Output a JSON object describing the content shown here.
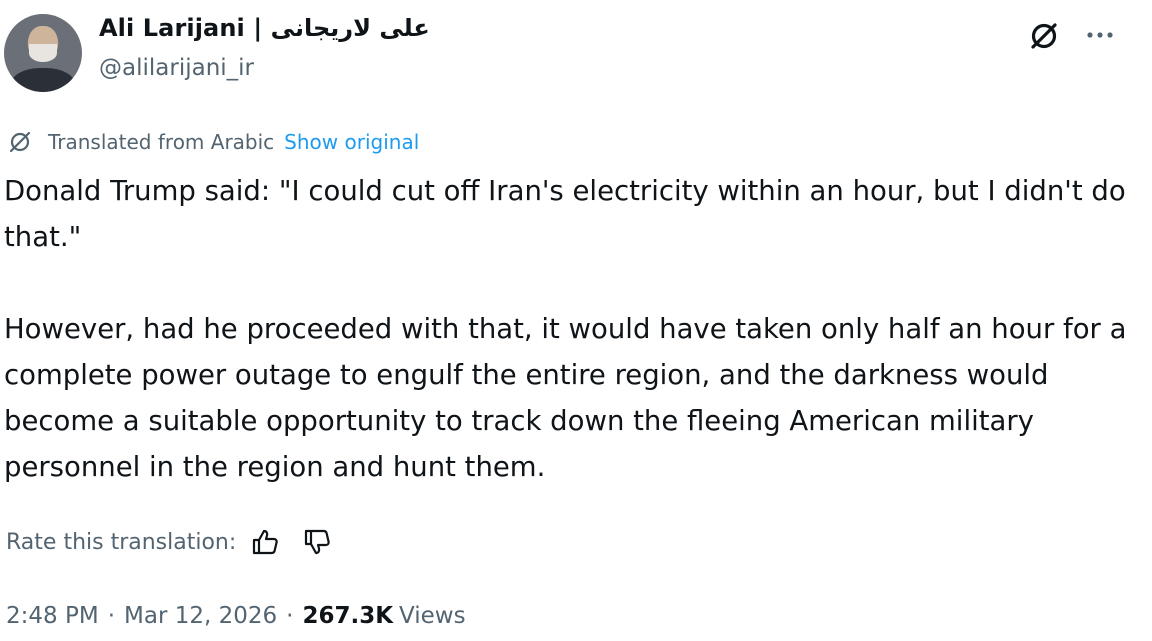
{
  "author": {
    "display_name": "Ali Larijani | علی لاریجانی",
    "handle": "@alilarijani_ir"
  },
  "header_icons": {
    "grok": "grok-icon",
    "more": "more-horizontal-icon"
  },
  "translation": {
    "notice": "Translated from Arabic",
    "show_original": "Show original",
    "icon": "grok-icon"
  },
  "tweet": {
    "paragraphs": [
      "Donald Trump said: \"I could cut off Iran's electricity within an hour, but I didn't do that.\"",
      "However, had he proceeded with that, it would have taken only half an hour for a complete power outage to engulf the entire region, and the darkness would become a suitable opportunity to track down the fleeing American military personnel in the region and hunt them."
    ]
  },
  "rating": {
    "label": "Rate this translation:",
    "icons": [
      "thumbs-up-icon",
      "thumbs-down-icon"
    ]
  },
  "meta": {
    "time": "2:48 PM",
    "separator": "·",
    "date": "Mar 12, 2026",
    "views_count": "267.3K",
    "views_label": "Views"
  },
  "colors": {
    "text": "#0f1419",
    "secondary": "#536471",
    "link": "#1d9bf0"
  }
}
